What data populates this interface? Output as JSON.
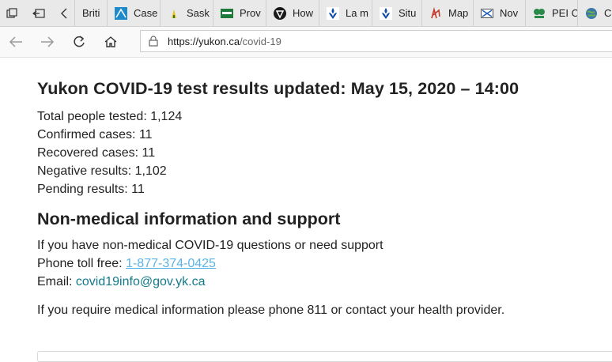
{
  "browser": {
    "tabs": [
      {
        "label": "Briti",
        "icon": "bc-icon"
      },
      {
        "label": "Case",
        "icon": "alberta-icon"
      },
      {
        "label": "Sask",
        "icon": "saskatchewan-icon"
      },
      {
        "label": "Prov",
        "icon": "manitoba-icon"
      },
      {
        "label": "How",
        "icon": "ontario-icon"
      },
      {
        "label": "La m",
        "icon": "quebec-icon"
      },
      {
        "label": "Situ",
        "icon": "quebec-icon"
      },
      {
        "label": "Map",
        "icon": "newbrunswick-icon"
      },
      {
        "label": "Nov",
        "icon": "novascotia-icon"
      },
      {
        "label": "PEI C",
        "icon": "pei-icon"
      },
      {
        "label": "Co",
        "icon": "globe-icon"
      }
    ],
    "url_host": "https://yukon.ca",
    "url_path": "/covid-19"
  },
  "page": {
    "title": "Yukon COVID-19 test results updated: May 15, 2020 – 14:00",
    "stats": [
      "Total people tested: 1,124",
      "Confirmed cases: 11",
      "Recovered cases: 11",
      "Negative results: 1,102",
      "Pending results: 11"
    ],
    "support_heading": "Non-medical information and support",
    "support_intro": "If you have non-medical COVID-19 questions or need support",
    "phone_label": "Phone toll free: ",
    "phone_number": "1-877-374-0425",
    "email_label": "Email: ",
    "email": "covid19info@gov.yk.ca",
    "medical_note": "If you require medical information please phone 811 or contact your health provider."
  }
}
